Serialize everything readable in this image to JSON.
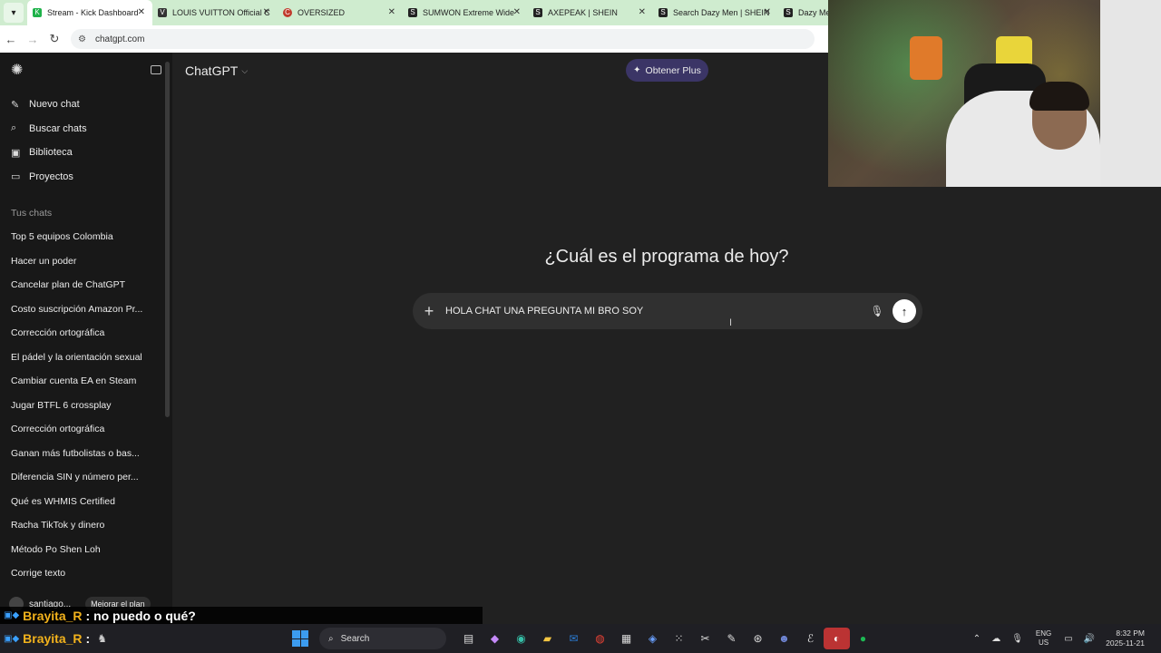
{
  "browser": {
    "tabs": [
      {
        "label": "Stream - Kick Dashboard",
        "favicon": "kick-icon",
        "color": "#1fb24a"
      },
      {
        "label": "LOUIS VUITTON Official C",
        "favicon": "lv-icon",
        "color": "#333333"
      },
      {
        "label": "OVERSIZED",
        "favicon": "oversized-icon",
        "color": "#c0392b"
      },
      {
        "label": "SUMWON Extreme Wide",
        "favicon": "shein-icon",
        "color": "#222222"
      },
      {
        "label": "AXEPEAK | SHEIN",
        "favicon": "shein-icon",
        "color": "#222222"
      },
      {
        "label": "Search Dazy Men | SHEIN",
        "favicon": "shein-icon",
        "color": "#222222"
      },
      {
        "label": "Dazy Men",
        "favicon": "shein-icon",
        "color": "#222222"
      }
    ],
    "url": "chatgpt.com"
  },
  "sidebar": {
    "actions": [
      {
        "label": "Nuevo chat",
        "icon": "new-chat-icon"
      },
      {
        "label": "Buscar chats",
        "icon": "search-icon"
      },
      {
        "label": "Biblioteca",
        "icon": "library-icon"
      },
      {
        "label": "Proyectos",
        "icon": "folder-icon"
      }
    ],
    "section_label": "Tus chats",
    "chats": [
      "Top 5 equipos Colombia",
      "Hacer un poder",
      "Cancelar plan de ChatGPT",
      "Costo suscripción Amazon Pr...",
      "Corrección ortográfica",
      "El pádel y la orientación sexual",
      "Cambiar cuenta EA en Steam",
      "Jugar BTFL 6 crossplay",
      "Corrección ortográfica",
      "Ganan más futbolistas o bas...",
      "Diferencia SIN y número per...",
      "Qué es WHMIS Certified",
      "Racha TikTok y dinero",
      "Método Po Shen Loh",
      "Corrige texto"
    ],
    "user_name": "santiago...",
    "upgrade_label": "Mejorar el plan"
  },
  "main": {
    "model_label": "ChatGPT",
    "plus_label": "Obtener Plus",
    "headline": "¿Cuál es el programa de hoy?",
    "composer_text": "HOLA CHAT UNA PREGUNTA MI BRO SOY"
  },
  "stream_chat": {
    "line1_user": "Brayita_R",
    "line1_msg": ": no puedo o qué?",
    "line2_user": "Brayita_R",
    "line2_msg": ":"
  },
  "taskbar": {
    "search_placeholder": "Search",
    "lang_top": "ENG",
    "lang_bottom": "US",
    "time": "8:32 PM",
    "date": "2025-11-21"
  },
  "colors": {
    "background": "#212121",
    "sidebar": "#181818",
    "composer": "#303030",
    "plus_button": "#3b3566",
    "chat_username": "#f2b21c"
  }
}
